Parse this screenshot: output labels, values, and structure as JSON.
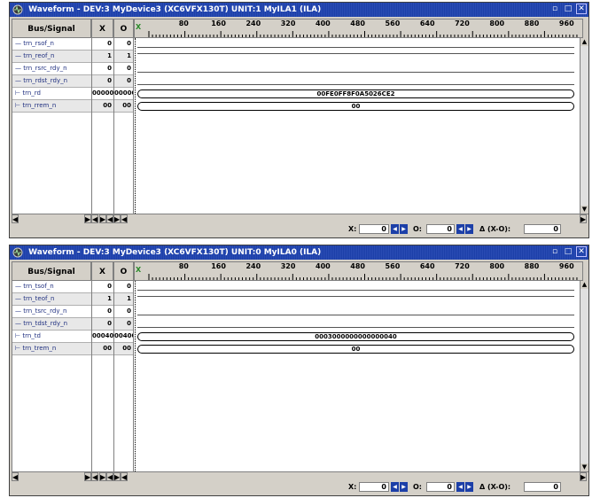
{
  "windows": [
    {
      "title": "Waveform - DEV:3 MyDevice3 (XC6VFX130T) UNIT:1 MyILA1 (ILA)",
      "headers": {
        "signal": "Bus/Signal",
        "x": "X",
        "o": "O"
      },
      "ruler_ticks": [
        "80",
        "160",
        "240",
        "320",
        "400",
        "480",
        "560",
        "640",
        "720",
        "800",
        "880",
        "960"
      ],
      "signals": [
        {
          "name": "trn_rsof_n",
          "x": "0",
          "o": "0",
          "type": "bit",
          "expand": false
        },
        {
          "name": "trn_reof_n",
          "x": "1",
          "o": "1",
          "type": "bit",
          "expand": false
        },
        {
          "name": "trn_rsrc_rdy_n",
          "x": "0",
          "o": "0",
          "type": "bit",
          "expand": false
        },
        {
          "name": "trn_rdst_rdy_n",
          "x": "0",
          "o": "0",
          "type": "bit",
          "expand": false
        },
        {
          "name": "trn_rd",
          "x": "00000",
          "o": "00000",
          "type": "bus",
          "value": "00FE0FF8F0A5026CE2",
          "expand": true
        },
        {
          "name": "trn_rrem_n",
          "x": "00",
          "o": "00",
          "type": "bus",
          "value": "00",
          "expand": true
        }
      ],
      "status": {
        "x_label": "X:",
        "x_value": "0",
        "o_label": "O:",
        "o_value": "0",
        "delta_label": "Δ (X-O):",
        "delta_value": "0"
      }
    },
    {
      "title": "Waveform - DEV:3 MyDevice3 (XC6VFX130T) UNIT:0 MyILA0 (ILA)",
      "headers": {
        "signal": "Bus/Signal",
        "x": "X",
        "o": "O"
      },
      "ruler_ticks": [
        "80",
        "160",
        "240",
        "320",
        "400",
        "480",
        "560",
        "640",
        "720",
        "800",
        "880",
        "960"
      ],
      "signals": [
        {
          "name": "trn_tsof_n",
          "x": "0",
          "o": "0",
          "type": "bit",
          "expand": false
        },
        {
          "name": "trn_teof_n",
          "x": "1",
          "o": "1",
          "type": "bit",
          "expand": false
        },
        {
          "name": "trn_tsrc_rdy_n",
          "x": "0",
          "o": "0",
          "type": "bit",
          "expand": false
        },
        {
          "name": "trn_tdst_rdy_n",
          "x": "0",
          "o": "0",
          "type": "bit",
          "expand": false
        },
        {
          "name": "trn_td",
          "x": "00040",
          "o": "00400",
          "type": "bus",
          "value": "0003000000000000040",
          "expand": true
        },
        {
          "name": "trn_trem_n",
          "x": "00",
          "o": "00",
          "type": "bus",
          "value": "00",
          "expand": true
        }
      ],
      "status": {
        "x_label": "X:",
        "x_value": "0",
        "o_label": "O:",
        "o_value": "0",
        "delta_label": "Δ (X-O):",
        "delta_value": "0"
      }
    }
  ],
  "colors": {
    "titlebar": "#1c3fa8",
    "panel": "#d4d0c8"
  },
  "icons": {
    "window": "waveform-app-icon",
    "minimize": "restore-icon",
    "maximize": "maximize-icon",
    "close": "close-icon"
  }
}
